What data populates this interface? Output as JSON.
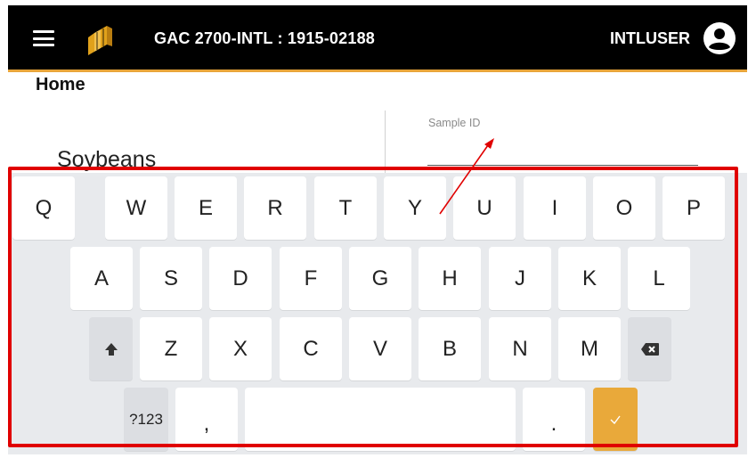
{
  "header": {
    "device_title": "GAC 2700-INTL : 1915-02188",
    "user_name": "INTLUSER",
    "accent_color": "#e8a53a"
  },
  "page": {
    "title": "Home",
    "crop_value": "Soybeans",
    "sample_id_label": "Sample ID",
    "sample_id_value": ""
  },
  "keyboard": {
    "row1": [
      "Q",
      "W",
      "E",
      "R",
      "T",
      "Y",
      "U",
      "I",
      "O",
      "P"
    ],
    "row2": [
      "A",
      "S",
      "D",
      "F",
      "G",
      "H",
      "J",
      "K",
      "L"
    ],
    "row3": [
      "Z",
      "X",
      "C",
      "V",
      "B",
      "N",
      "M"
    ],
    "symbols_label": "?123",
    "comma_label": ",",
    "period_label": ".",
    "enter_color": "#e9a93a"
  },
  "annotation": {
    "box_color": "#e00000"
  }
}
